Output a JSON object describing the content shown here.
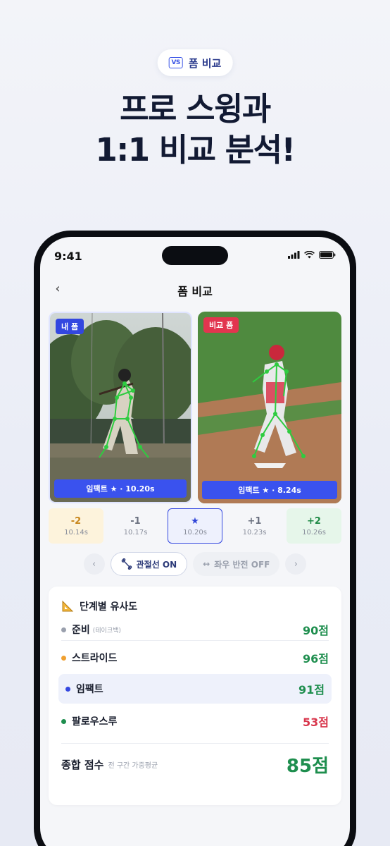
{
  "badge": {
    "icon": "vs-icon",
    "icon_text": "VS",
    "label": "폼 비교"
  },
  "headline": {
    "line1": "프로 스윙과",
    "line2": "1:1 비교 분석!"
  },
  "status": {
    "time": "9:41"
  },
  "nav": {
    "title": "폼 비교",
    "back_icon": "chevron-left-icon"
  },
  "videos": [
    {
      "tag": "내 폼",
      "caption": "임팩트 ★ · 10.20s",
      "tag_color": "#3347e0"
    },
    {
      "tag": "비교 폼",
      "caption": "임팩트 ★ · 8.24s",
      "tag_color": "#e2354f"
    }
  ],
  "frames": [
    {
      "delta": "-2",
      "time": "10.14s",
      "bg": "#fdf3dc",
      "color": "#c8861c"
    },
    {
      "delta": "-1",
      "time": "10.17s",
      "bg": "#f5f6f9",
      "color": "#6b7180"
    },
    {
      "delta": "★",
      "time": "10.20s",
      "bg": "#eef1fd",
      "color": "#2f45d8",
      "selected": true
    },
    {
      "delta": "+1",
      "time": "10.23s",
      "bg": "#f5f6f9",
      "color": "#6b7180"
    },
    {
      "delta": "+2",
      "time": "10.26s",
      "bg": "#e6f6ea",
      "color": "#1f8a46"
    }
  ],
  "controls": {
    "prev_icon": "chevron-left-icon",
    "next_icon": "chevron-right-icon",
    "skeleton_label": "관절선 ON",
    "mirror_label": "좌우 반전 OFF"
  },
  "similarity": {
    "title": "단계별 유사도",
    "title_icon": "ruler-triangle-icon",
    "rows": [
      {
        "label": "준비",
        "sub": "(테이크백)",
        "score": "90점",
        "dot": "#9aa0ad",
        "color": "#1e8e4e"
      },
      {
        "label": "스트라이드",
        "sub": "",
        "score": "96점",
        "dot": "#f0a030",
        "color": "#1e8e4e"
      },
      {
        "label": "임팩트",
        "sub": "",
        "score": "91점",
        "dot": "#3347e0",
        "color": "#1e8e4e",
        "highlight": true
      },
      {
        "label": "팔로우스루",
        "sub": "",
        "score": "53점",
        "dot": "#1e8e4e",
        "color": "#d8354b"
      }
    ],
    "total_label": "종합 점수",
    "total_sub": "전 구간 가중평균",
    "total_score": "85점"
  }
}
